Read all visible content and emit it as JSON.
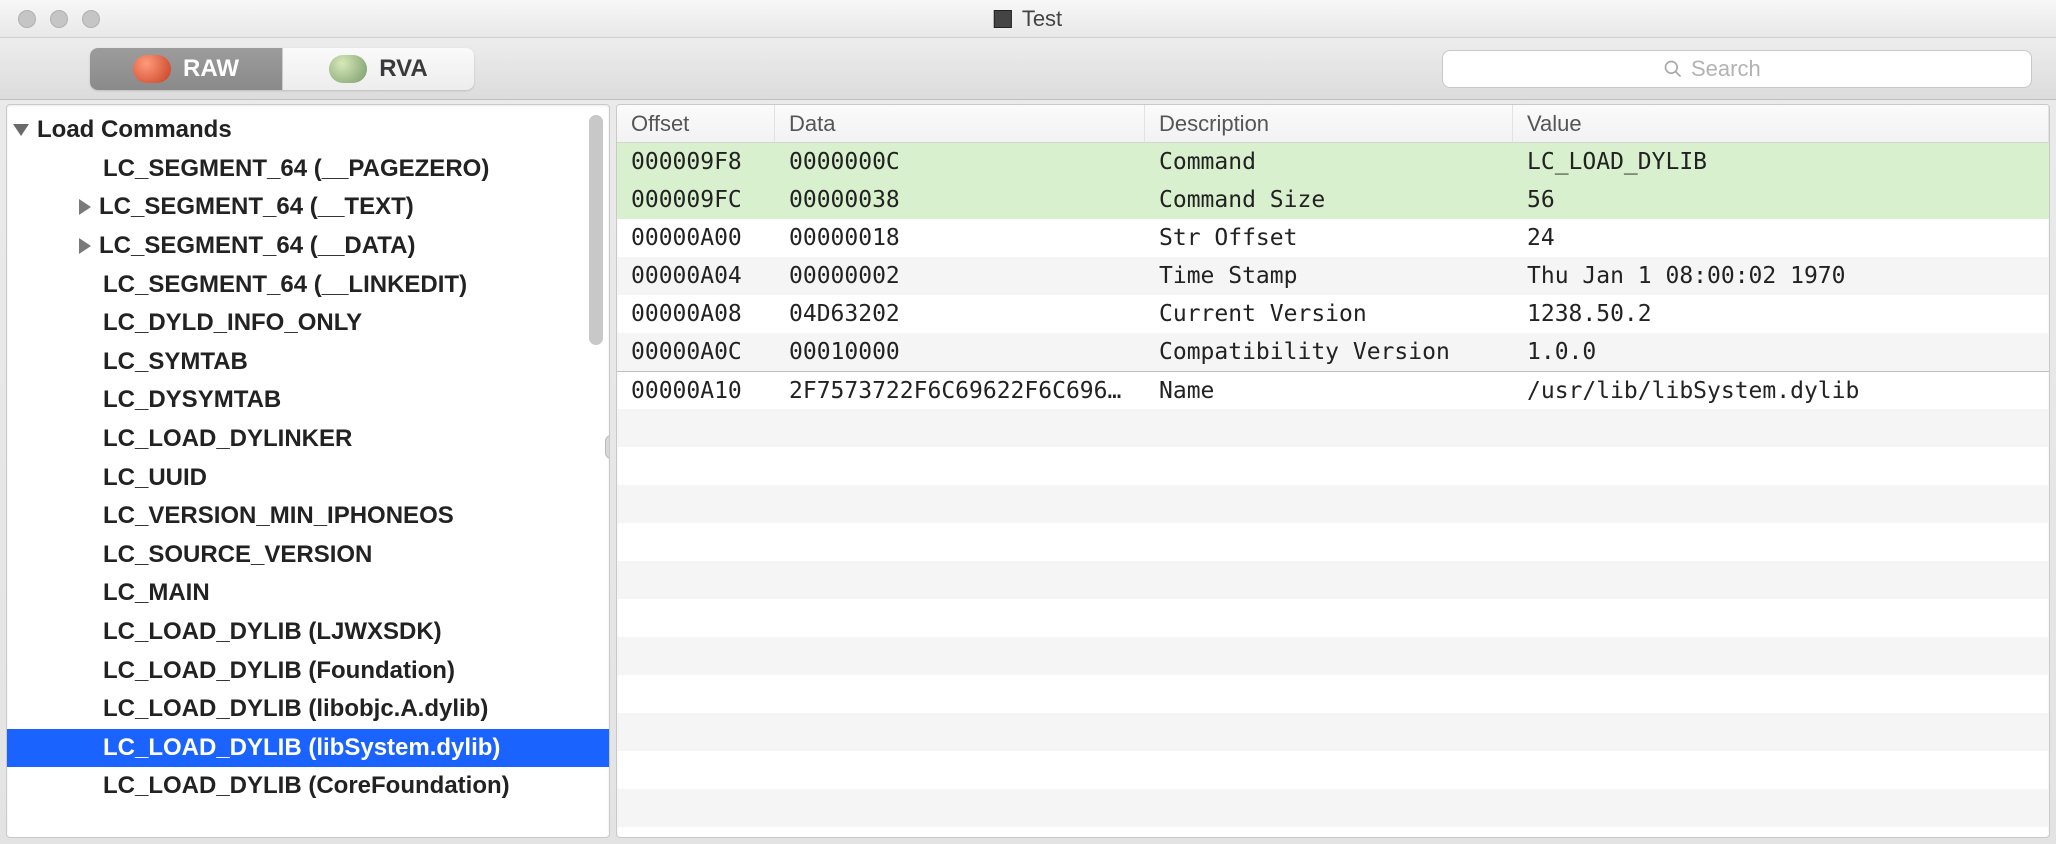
{
  "window": {
    "title": "Test"
  },
  "toolbar": {
    "raw_label": "RAW",
    "rva_label": "RVA",
    "search_placeholder": "Search"
  },
  "sidebar": {
    "root_label": "Load Commands",
    "items": [
      {
        "label": "LC_SEGMENT_64 (__PAGEZERO)",
        "expandable": false
      },
      {
        "label": "LC_SEGMENT_64 (__TEXT)",
        "expandable": true
      },
      {
        "label": "LC_SEGMENT_64 (__DATA)",
        "expandable": true
      },
      {
        "label": "LC_SEGMENT_64 (__LINKEDIT)",
        "expandable": false
      },
      {
        "label": "LC_DYLD_INFO_ONLY",
        "expandable": false
      },
      {
        "label": "LC_SYMTAB",
        "expandable": false
      },
      {
        "label": "LC_DYSYMTAB",
        "expandable": false
      },
      {
        "label": "LC_LOAD_DYLINKER",
        "expandable": false
      },
      {
        "label": "LC_UUID",
        "expandable": false
      },
      {
        "label": "LC_VERSION_MIN_IPHONEOS",
        "expandable": false
      },
      {
        "label": "LC_SOURCE_VERSION",
        "expandable": false
      },
      {
        "label": "LC_MAIN",
        "expandable": false
      },
      {
        "label": "LC_LOAD_DYLIB (LJWXSDK)",
        "expandable": false
      },
      {
        "label": "LC_LOAD_DYLIB (Foundation)",
        "expandable": false
      },
      {
        "label": "LC_LOAD_DYLIB (libobjc.A.dylib)",
        "expandable": false
      },
      {
        "label": "LC_LOAD_DYLIB (libSystem.dylib)",
        "expandable": false,
        "selected": true
      },
      {
        "label": "LC_LOAD_DYLIB (CoreFoundation)",
        "expandable": false
      }
    ]
  },
  "table": {
    "headers": {
      "offset": "Offset",
      "data": "Data",
      "desc": "Description",
      "value": "Value"
    },
    "rows": [
      {
        "offset": "000009F8",
        "data": "0000000C",
        "desc": "Command",
        "value": "LC_LOAD_DYLIB",
        "hl": true
      },
      {
        "offset": "000009FC",
        "data": "00000038",
        "desc": "Command Size",
        "value": "56",
        "hl": true
      },
      {
        "offset": "00000A00",
        "data": "00000018",
        "desc": "Str Offset",
        "value": "24"
      },
      {
        "offset": "00000A04",
        "data": "00000002",
        "desc": "Time Stamp",
        "value": "Thu Jan  1 08:00:02 1970"
      },
      {
        "offset": "00000A08",
        "data": "04D63202",
        "desc": "Current Version",
        "value": "1238.50.2"
      },
      {
        "offset": "00000A0C",
        "data": "00010000",
        "desc": "Compatibility Version",
        "value": "1.0.0"
      },
      {
        "offset": "00000A10",
        "data": "2F7573722F6C69622F6C696…",
        "desc": "Name",
        "value": "/usr/lib/libSystem.dylib",
        "topline": true
      }
    ],
    "blank_rows": 11
  }
}
